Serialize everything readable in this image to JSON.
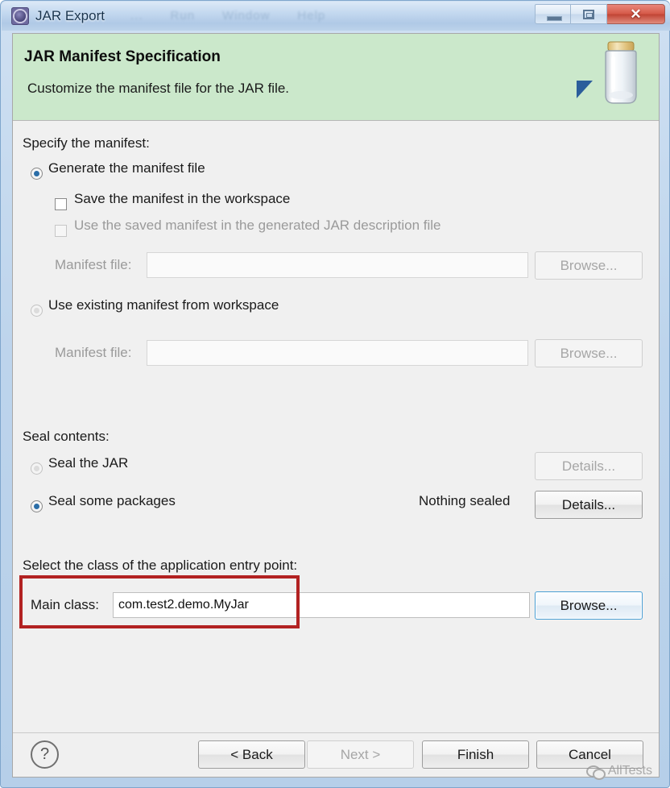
{
  "window": {
    "title": "JAR Export",
    "app_icon": "jar-export-icon",
    "ghost_menu_items": [
      "...",
      "Run",
      "Window",
      "Help"
    ],
    "controls": {
      "minimize": "minimize-icon",
      "maximize": "maximize-icon",
      "close": "✕"
    }
  },
  "header": {
    "title": "JAR Manifest Specification",
    "subtitle": "Customize the manifest file for the JAR file.",
    "banner_icon": "jar-jar-illustration-icon",
    "arrow_icon": "blue-arrow-icon",
    "background_color": "#cbe8cb"
  },
  "manifest_section": {
    "group_label": "Specify the manifest:",
    "options": [
      {
        "label": "Generate the manifest file",
        "selected": true,
        "enabled": true
      },
      {
        "label": "Use existing manifest from workspace",
        "selected": false,
        "enabled": true
      }
    ],
    "checkboxes": [
      {
        "label": "Save the manifest in the workspace",
        "checked": false,
        "enabled": true
      },
      {
        "label": "Use the saved manifest in the generated JAR description file",
        "checked": false,
        "enabled": false
      }
    ],
    "file_rows": [
      {
        "label": "Manifest file:",
        "value": "",
        "enabled": false,
        "button": "Browse..."
      },
      {
        "label": "Manifest file:",
        "value": "",
        "enabled": false,
        "button": "Browse..."
      }
    ]
  },
  "seal_section": {
    "group_label": "Seal contents:",
    "options": [
      {
        "label": "Seal the JAR",
        "selected": false,
        "enabled": true,
        "button": "Details...",
        "button_enabled": false,
        "status": ""
      },
      {
        "label": "Seal some packages",
        "selected": true,
        "enabled": true,
        "button": "Details...",
        "button_enabled": true,
        "status": "Nothing sealed"
      }
    ]
  },
  "entry_point_section": {
    "group_label": "Select the class of the application entry point:",
    "main_class_label": "Main class:",
    "main_class_value": "com.test2.demo.MyJar",
    "browse_button": "Browse...",
    "highlight_color": "#b22222"
  },
  "footer": {
    "help_icon": "?",
    "buttons": [
      {
        "label": "< Back",
        "enabled": true
      },
      {
        "label": "Next >",
        "enabled": false
      },
      {
        "label": "Finish",
        "enabled": true
      },
      {
        "label": "Cancel",
        "enabled": true
      }
    ]
  },
  "watermark": {
    "text": "AllTests",
    "icon": "wechat-icon"
  }
}
